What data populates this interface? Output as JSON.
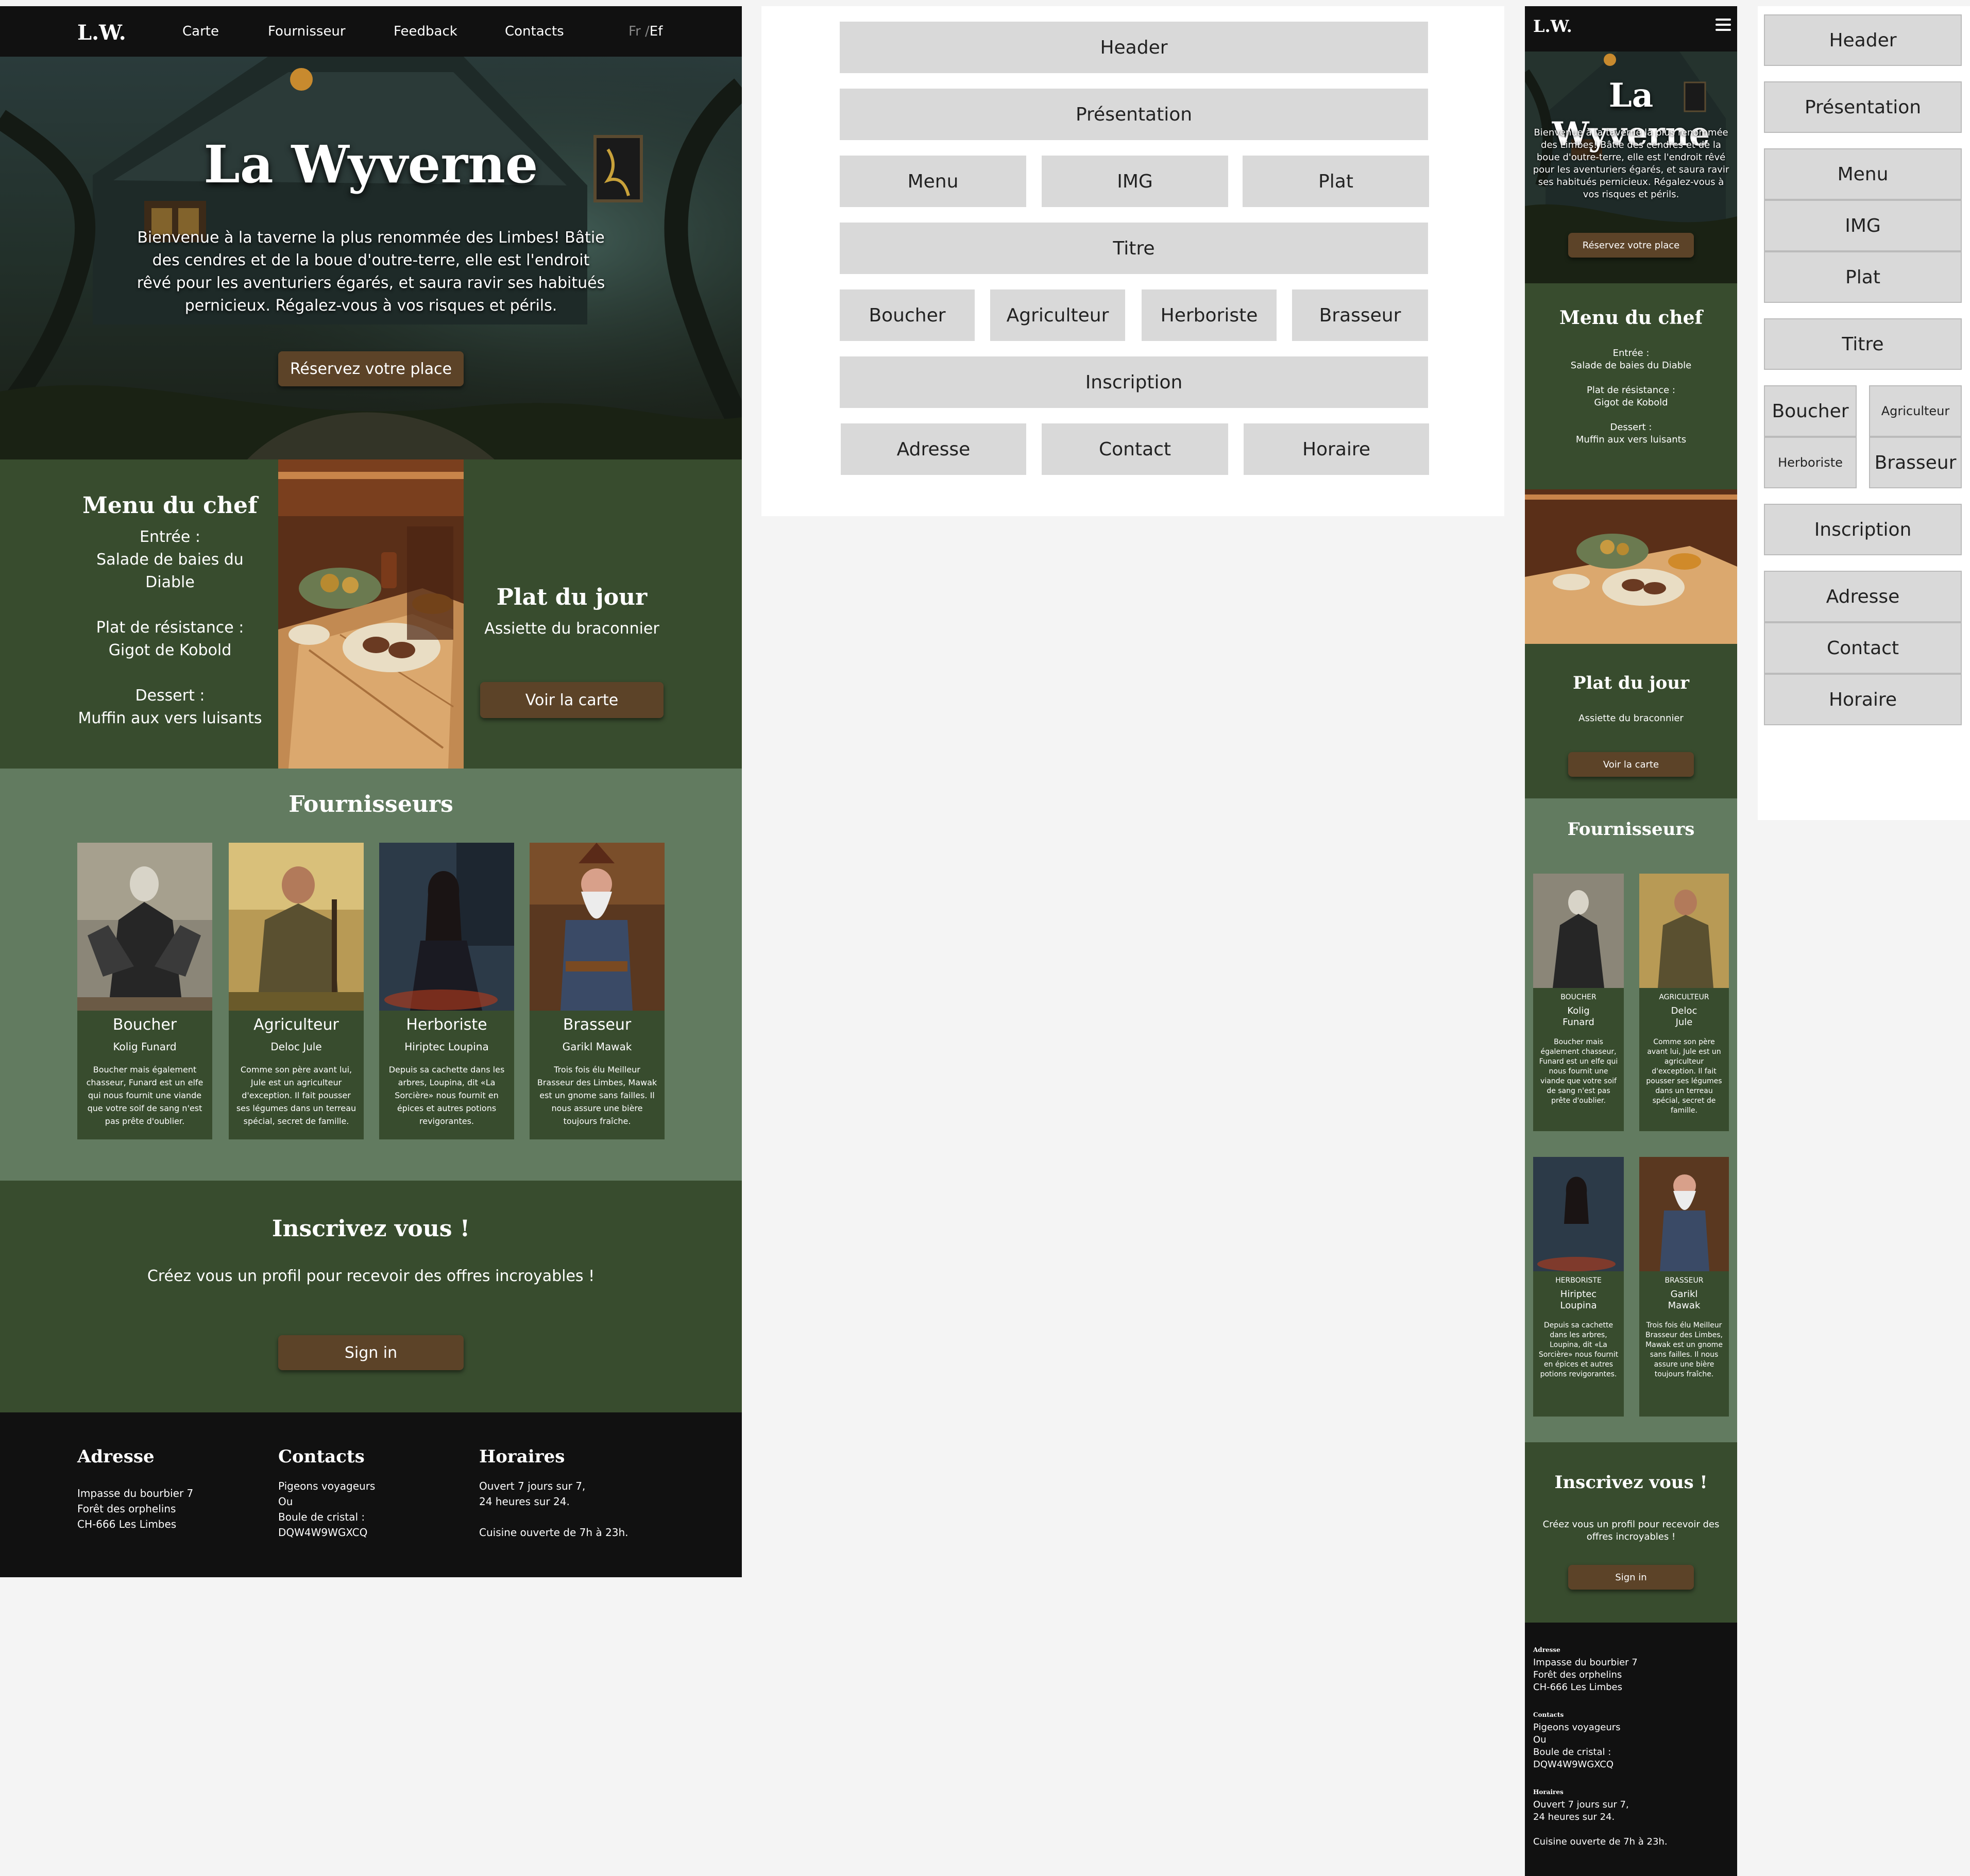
{
  "desktop": {
    "header": {
      "logo": "L.W.",
      "nav": [
        "Carte",
        "Fournisseur",
        "Feedback",
        "Contacts"
      ],
      "lang_inactive": "Fr / ",
      "lang_active": "Ef"
    },
    "hero": {
      "title": "La Wyverne",
      "intro": "Bienvenue à la taverne la plus renommée des Limbes! Bâtie des cendres et de la boue d'outre-terre, elle est l'endroit rêvé pour les aventuriers égarés, et saura ravir ses habitués pernicieux. Régalez-vous à vos risques et périls.",
      "button": "Réservez votre place"
    },
    "menu": {
      "title": "Menu du chef",
      "entree_label": "Entrée :",
      "entree": "Salade de baies du Diable",
      "plat_label": "Plat de résistance :",
      "plat": "Gigot de Kobold",
      "dessert_label": "Dessert :",
      "dessert": "Muffin aux vers luisants",
      "plat_du_jour_title": "Plat du jour",
      "plat_du_jour": "Assiette du braconnier",
      "button": "Voir la carte"
    },
    "suppliers": {
      "title": "Fournisseurs",
      "items": [
        {
          "role": "Boucher",
          "name": "Kolig Funard",
          "desc": "Boucher mais également chasseur, Funard est un elfe qui nous fournit une viande que votre soif de sang n'est pas prête d'oublier."
        },
        {
          "role": "Agriculteur",
          "name": "Deloc Jule",
          "desc": "Comme son père avant lui, Jule est un agriculteur d'exception. Il fait pousser ses légumes dans un terreau spécial, secret de famille."
        },
        {
          "role": "Herboriste",
          "name": "Hiriptec Loupina",
          "desc": "Depuis sa cachette dans les arbres, Loupina, dit «La Sorcière» nous fournit en épices et autres potions revigorantes."
        },
        {
          "role": "Brasseur",
          "name": "Garikl Mawak",
          "desc": "Trois fois élu Meilleur Brasseur des Limbes, Mawak est un gnome sans failles. Il nous assure une bière toujours fraîche."
        }
      ]
    },
    "signup": {
      "title": "Inscrivez vous !",
      "text": "Créez vous un profil pour recevoir des offres incroyables !",
      "button": "Sign in"
    },
    "footer": {
      "address_title": "Adresse",
      "address": [
        "Impasse du bourbier 7",
        "Forêt des orphelins",
        "CH-666 Les Limbes"
      ],
      "contacts_title": "Contacts",
      "contacts": [
        "Pigeons voyageurs",
        "Ou",
        "Boule de cristal :",
        "DQW4W9WGXCQ"
      ],
      "hours_title": "Horaires",
      "hours": [
        "Ouvert 7 jours sur 7,",
        "24 heures sur 24.",
        "",
        "Cuisine ouverte de 7h à 23h."
      ]
    }
  },
  "wireframe_desktop": [
    "Header",
    "Présentation",
    "Menu",
    "IMG",
    "Plat",
    "Titre",
    "Boucher",
    "Agriculteur",
    "Herboriste",
    "Brasseur",
    "Inscription",
    "Adresse",
    "Contact",
    "Horaire"
  ],
  "mobile": {
    "logo": "L.W.",
    "hero_title": "La Wyverne",
    "intro": "Bienvenue à la taverne la plus renommée des Limbes! Bâtie des cendres et de la boue d'outre-terre, elle est l'endroit rêvé pour les aventuriers égarés, et saura ravir ses habitués pernicieux. Régalez-vous à vos risques et périls.",
    "hero_button": "Réservez votre place",
    "menu_title": "Menu du chef",
    "entree_label": "Entrée :",
    "entree": "Salade de baies du Diable",
    "plat_label": "Plat de résistance :",
    "plat": "Gigot de Kobold",
    "dessert_label": "Dessert :",
    "dessert": "Muffin aux vers luisants",
    "plat_du_jour_title": "Plat du jour",
    "plat_du_jour": "Assiette du braconnier",
    "plat_button": "Voir la carte",
    "suppliers_title": "Fournisseurs",
    "suppliers": [
      {
        "role": "BOUCHER",
        "name": "Kolig Funard",
        "desc": "Boucher mais également chasseur, Funard est un elfe qui nous fournit une viande que votre soif de sang n'est pas prête d'oublier."
      },
      {
        "role": "AGRICULTEUR",
        "name": "Deloc Jule",
        "desc": "Comme son père avant lui, Jule est un agriculteur d'exception. Il fait pousser ses légumes dans un terreau spécial, secret de famille."
      },
      {
        "role": "HERBORISTE",
        "name": "Hiriptec Loupina",
        "desc": "Depuis sa cachette dans les arbres, Loupina, dit «La Sorcière» nous fournit en épices et autres potions revigorantes."
      },
      {
        "role": "BRASSEUR",
        "name": "Garikl Mawak",
        "desc": "Trois fois élu Meilleur Brasseur des Limbes, Mawak est un gnome sans failles. Il nous assure une bière toujours fraîche."
      }
    ],
    "signup_title": "Inscrivez vous !",
    "signup_text": "Créez vous un profil pour recevoir des offres incroyables !",
    "signup_button": "Sign in",
    "footer": {
      "address_title": "Adresse",
      "address": [
        "Impasse du bourbier 7",
        "Forêt des orphelins",
        "CH-666 Les Limbes"
      ],
      "contacts_title": "Contacts",
      "contacts": [
        "Pigeons voyageurs",
        "Ou",
        "Boule de cristal :",
        "DQW4W9WGXCQ"
      ],
      "hours_title": "Horaires",
      "hours": [
        "Ouvert 7 jours sur 7,",
        "24 heures sur 24.",
        "",
        "Cuisine ouverte de 7h à 23h."
      ]
    }
  },
  "wireframe_mobile": [
    "Header",
    "Présentation",
    "Menu",
    "IMG",
    "Plat",
    "Titre",
    "Boucher",
    "Agriculteur",
    "Herboriste",
    "Brasseur",
    "Inscription",
    "Adresse",
    "Contact",
    "Horaire"
  ],
  "colors": {
    "dark_green": "#384c2e",
    "sage_green": "#627b60",
    "brown_button": "#5c4328",
    "black": "#111111",
    "wire_gray": "#d9d9d9"
  }
}
